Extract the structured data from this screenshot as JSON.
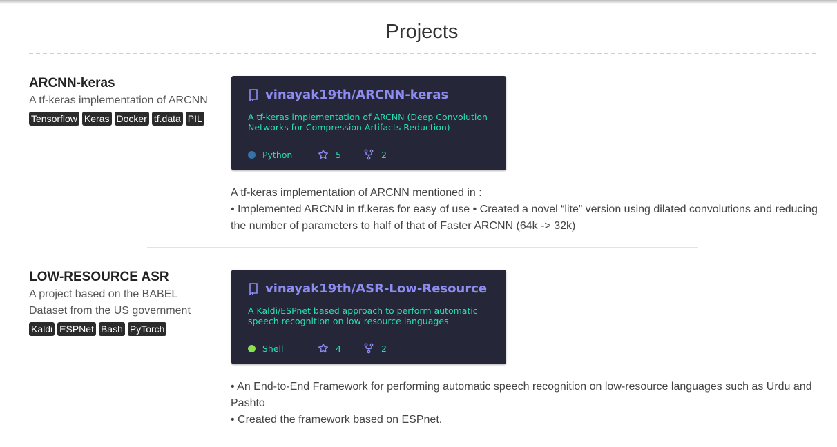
{
  "section": {
    "title": "Projects"
  },
  "projects": [
    {
      "name": "ARCNN-keras",
      "summary": "A tf-keras implementation of ARCNN",
      "tags": [
        "Tensorflow",
        "Keras",
        "Docker",
        "tf.data",
        "PIL"
      ],
      "repo": {
        "name": "vinayak19th/ARCNN-keras",
        "description": "A tf-keras implementation of ARCNN (Deep Convolution Networks for Compression Artifacts Reduction)",
        "language": "Python",
        "language_color": "#3572A5",
        "stars": "5",
        "forks": "2"
      },
      "description_lines": [
        "A tf-keras implementation of ARCNN mentioned in :",
        "• Implemented ARCNN in tf.keras for easy of use • Created a novel “lite” version using dilated convolutions and reducing the number of parameters to half of that of Faster ARCNN (64k -> 32k)"
      ]
    },
    {
      "name": "LOW-RESOURCE ASR",
      "summary": "A project based on the BABEL Dataset from the US government",
      "tags": [
        "Kaldi",
        "ESPNet",
        "Bash",
        "PyTorch"
      ],
      "repo": {
        "name": "vinayak19th/ASR-Low-Resource",
        "description": "A Kaldi/ESPnet based approach to perform automatic speech recognition on low resource languages",
        "language": "Shell",
        "language_color": "#89e051",
        "stars": "4",
        "forks": "2"
      },
      "description_lines": [
        "• An End-to-End Framework for performing automatic speech recognition on low-resource languages such as Urdu and Pashto",
        "• Created the framework based on ESPnet."
      ]
    }
  ],
  "colors": {
    "card_bg": "#252638",
    "repo_link": "#8e8cf1",
    "repo_text": "#27e0b0",
    "tag_bg": "#2b2b2b"
  }
}
